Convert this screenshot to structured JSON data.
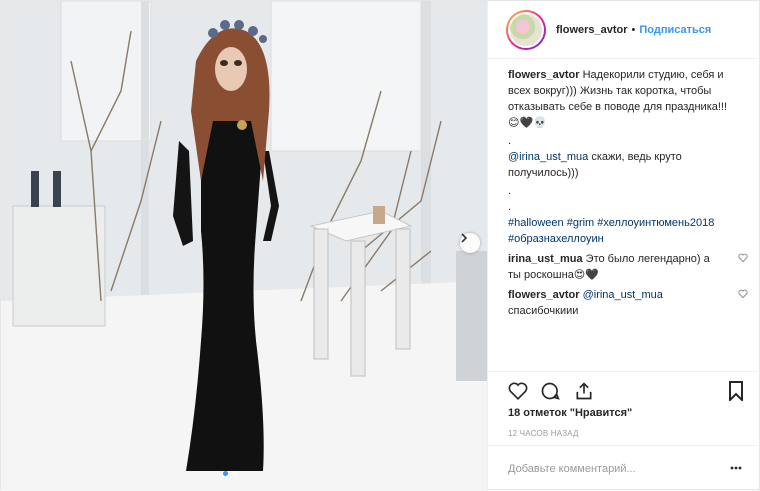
{
  "post": {
    "username": "flowers_avtor",
    "separator": "•",
    "follow_label": "Подписаться",
    "caption": {
      "user": "flowers_avtor",
      "text": "Надекорили студию, себя и всех вокруг))) Жизнь так коротка, чтобы отказывать себе в поводе для праздника!!! 😊🖤💀",
      "dot1": ".",
      "mention": "@irina_ust_mua",
      "mention_text": "скажи, ведь круто получилось)))",
      "dot2": ".",
      "dot3": ".",
      "tags": "#halloween #grim #хеллоуинтюмень2018 #образнахеллоуин"
    },
    "comments": [
      {
        "user": "irina_ust_mua",
        "text": "Это было легендарно) а ты роскошна😍🖤"
      },
      {
        "user": "flowers_avtor",
        "mention": "@irina_ust_mua",
        "text": "спасибочкиии"
      }
    ],
    "likes": "18 отметок \"Нравится\"",
    "time": "12 ЧАСОВ НАЗАД",
    "comment_placeholder": "Добавьте комментарий...",
    "icons": {
      "like": "heart-icon",
      "comment": "comment-icon",
      "share": "share-icon",
      "save": "bookmark-icon",
      "more": "more-icon",
      "next": "chevron-right-icon"
    },
    "colors": {
      "link": "#3897f0",
      "tag": "#003569",
      "text": "#262626"
    }
  }
}
